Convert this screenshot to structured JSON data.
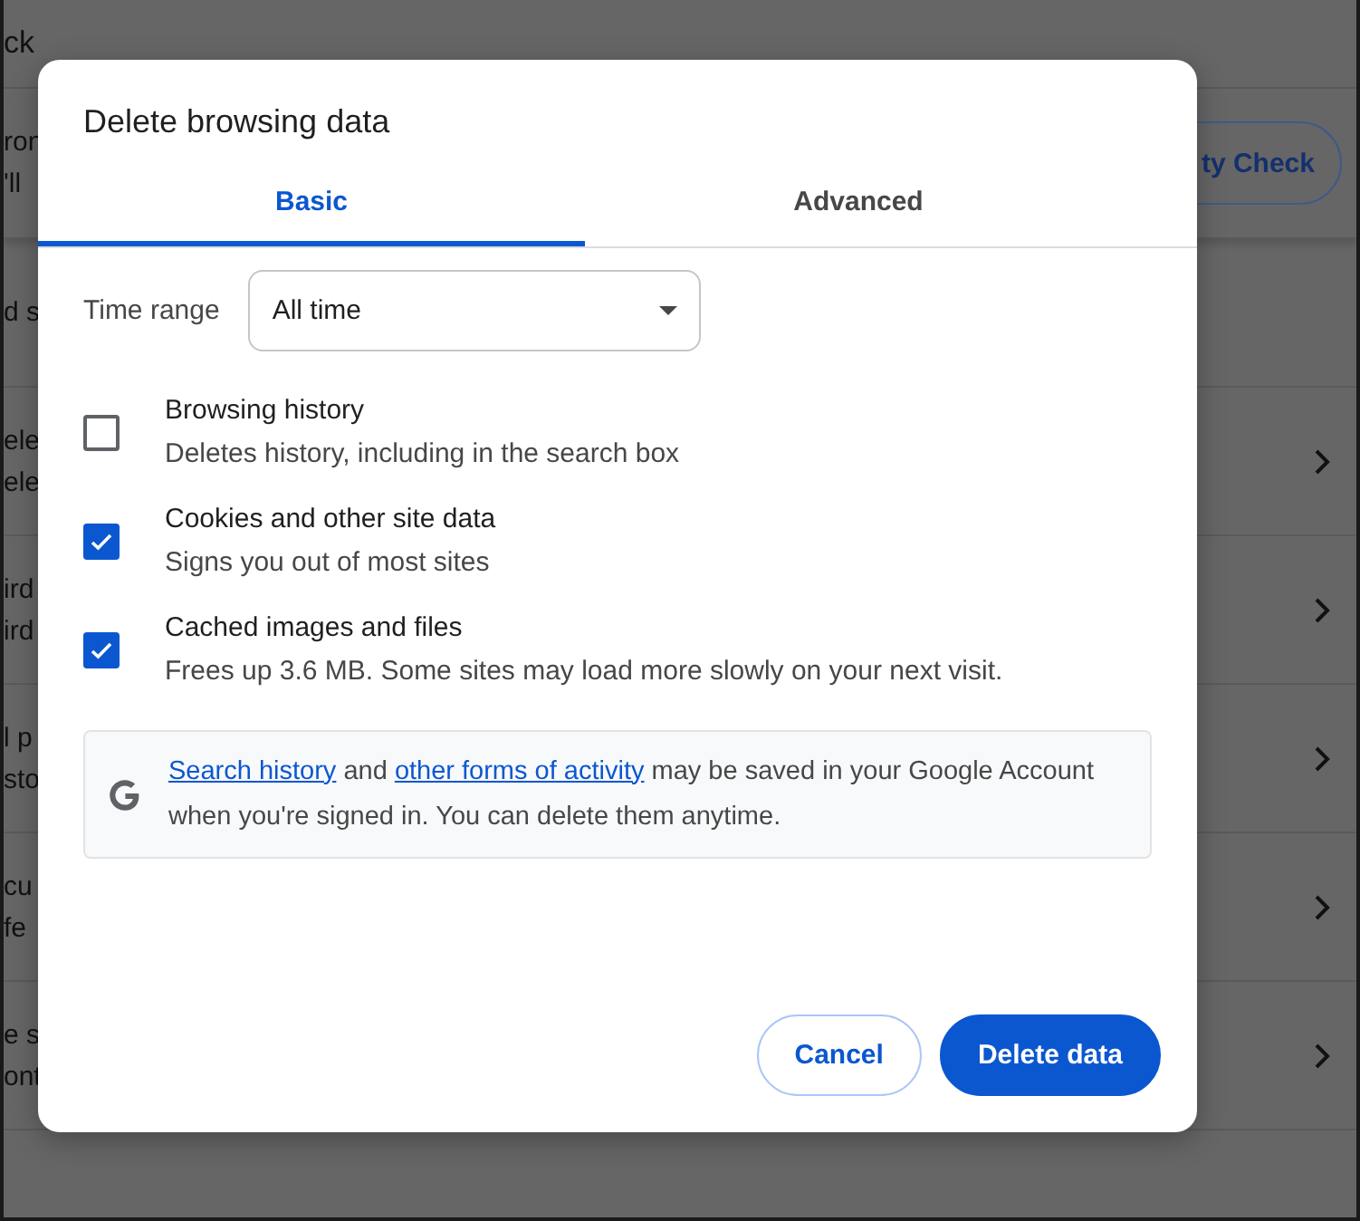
{
  "background": {
    "header_title": "ck",
    "banner": {
      "lines": [
        "ron",
        "'ll"
      ],
      "button": "ty Check"
    },
    "section_title": "d s",
    "rows": [
      {
        "lines": [
          "ele",
          "ele"
        ]
      },
      {
        "lines": [
          "ird",
          "ird"
        ]
      },
      {
        "lines": [
          "l p",
          "sto"
        ]
      },
      {
        "lines": [
          "cu",
          "fe"
        ]
      },
      {
        "lines": [
          "e s",
          "ont"
        ]
      }
    ]
  },
  "dialog": {
    "title": "Delete browsing data",
    "tabs": [
      {
        "label": "Basic",
        "selected": true
      },
      {
        "label": "Advanced",
        "selected": false
      }
    ],
    "time_range": {
      "label": "Time range",
      "value": "All time"
    },
    "options": [
      {
        "title": "Browsing history",
        "description": "Deletes history, including in the search box",
        "checked": false
      },
      {
        "title": "Cookies and other site data",
        "description": "Signs you out of most sites",
        "checked": true
      },
      {
        "title": "Cached images and files",
        "description": "Frees up 3.6 MB. Some sites may load more slowly on your next visit.",
        "checked": true
      }
    ],
    "info": [
      {
        "kind": "link",
        "text": "Search history"
      },
      {
        "kind": "text",
        "text": " and "
      },
      {
        "kind": "link",
        "text": "other forms of activity"
      },
      {
        "kind": "text",
        "text": " may be saved in your Google Account when you're signed in. You can delete them anytime."
      }
    ],
    "buttons": [
      {
        "label": "Cancel",
        "kind": "secondary"
      },
      {
        "label": "Delete data",
        "kind": "primary"
      }
    ]
  }
}
